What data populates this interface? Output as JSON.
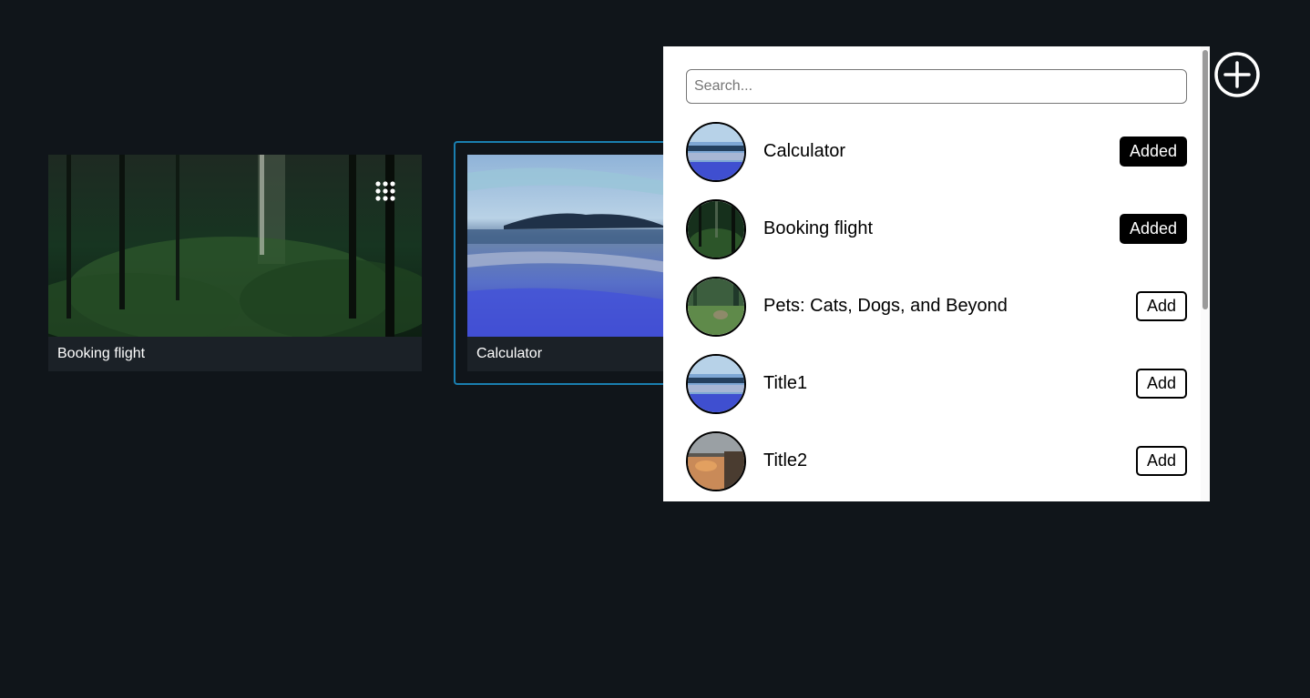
{
  "cards": [
    {
      "title": "Booking flight",
      "image": "forest-photo"
    },
    {
      "title": "Calculator",
      "image": "ocean-painting"
    }
  ],
  "panel": {
    "search": {
      "placeholder": "Search...",
      "value": ""
    },
    "items": [
      {
        "title": "Calculator",
        "button": "Added",
        "state": "added",
        "image": "ocean-painting"
      },
      {
        "title": "Booking flight",
        "button": "Added",
        "state": "added",
        "image": "forest-photo"
      },
      {
        "title": "Pets: Cats, Dogs, and Beyond",
        "button": "Add",
        "state": "not-added",
        "image": "meadow-photo"
      },
      {
        "title": "Title1",
        "button": "Add",
        "state": "not-added",
        "image": "ocean-painting"
      },
      {
        "title": "Title2",
        "button": "Add",
        "state": "not-added",
        "image": "sunset-photo"
      }
    ]
  },
  "icons": {
    "add": "plus-circle-icon",
    "drag": "grip-dots-icon"
  },
  "colors": {
    "background": "#10151a",
    "card_caption_bg": "#1b2127",
    "selected_border": "#1a7fb0",
    "added_button_bg": "#000000"
  }
}
